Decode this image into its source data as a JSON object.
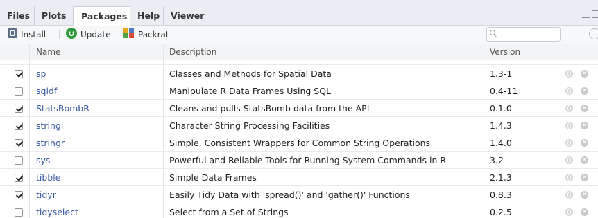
{
  "tabs": [
    {
      "label": "Files"
    },
    {
      "label": "Plots"
    },
    {
      "label": "Packages"
    },
    {
      "label": "Help"
    },
    {
      "label": "Viewer"
    }
  ],
  "toolbar": {
    "install_label": "Install",
    "update_label": "Update",
    "packrat_label": "Packrat"
  },
  "search": {
    "placeholder": "",
    "value": ""
  },
  "table": {
    "headers": {
      "name": "Name",
      "description": "Description",
      "version": "Version"
    },
    "rows": [
      {
        "checked": true,
        "name": "sp",
        "description": "Classes and Methods for Spatial Data",
        "version": "1.3-1"
      },
      {
        "checked": false,
        "name": "sqldf",
        "description": "Manipulate R Data Frames Using SQL",
        "version": "0.4-11"
      },
      {
        "checked": true,
        "name": "StatsBombR",
        "description": "Cleans and pulls StatsBomb data from the API",
        "version": "0.1.0"
      },
      {
        "checked": true,
        "name": "stringi",
        "description": "Character String Processing Facilities",
        "version": "1.4.3"
      },
      {
        "checked": true,
        "name": "stringr",
        "description": "Simple, Consistent Wrappers for Common String Operations",
        "version": "1.4.0"
      },
      {
        "checked": false,
        "name": "sys",
        "description": "Powerful and Reliable Tools for Running System Commands in R",
        "version": "3.2"
      },
      {
        "checked": true,
        "name": "tibble",
        "description": "Simple Data Frames",
        "version": "2.1.3"
      },
      {
        "checked": true,
        "name": "tidyr",
        "description": "Easily Tidy Data with 'spread()' and 'gather()' Functions",
        "version": "0.8.3"
      },
      {
        "checked": false,
        "name": "tidyselect",
        "description": "Select from a Set of Strings",
        "version": "0.2.5"
      }
    ]
  },
  "colors": {
    "link": "#3a5ba0",
    "update_green": "#2e9b3a"
  }
}
